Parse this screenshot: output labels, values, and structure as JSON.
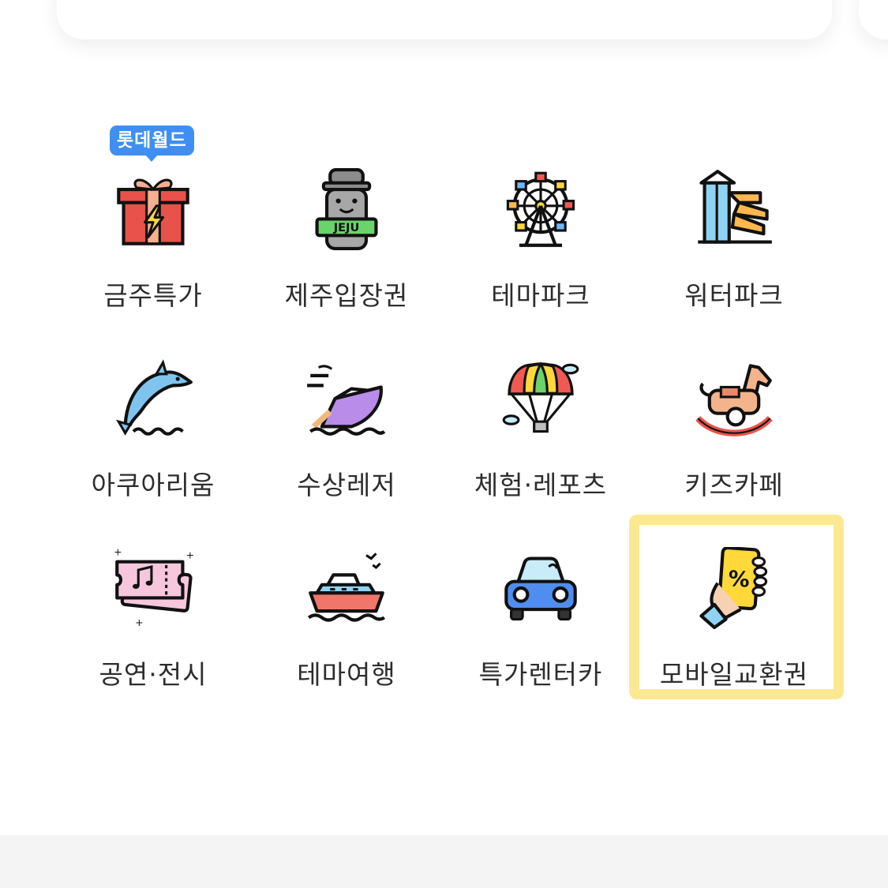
{
  "badge": {
    "label": "롯데월드"
  },
  "categories": [
    {
      "label": "금주특가",
      "icon": "gift-flash-icon"
    },
    {
      "label": "제주입장권",
      "icon": "jeju-stone-statue-icon"
    },
    {
      "label": "테마파크",
      "icon": "ferris-wheel-icon"
    },
    {
      "label": "워터파크",
      "icon": "water-slide-icon"
    },
    {
      "label": "아쿠아리움",
      "icon": "dolphin-icon"
    },
    {
      "label": "수상레저",
      "icon": "speedboat-icon"
    },
    {
      "label": "체험·레포츠",
      "icon": "parachute-icon"
    },
    {
      "label": "키즈카페",
      "icon": "rocking-horse-icon"
    },
    {
      "label": "공연·전시",
      "icon": "ticket-icon"
    },
    {
      "label": "테마여행",
      "icon": "cruise-ship-icon"
    },
    {
      "label": "특가렌터카",
      "icon": "car-icon"
    },
    {
      "label": "모바일교환권",
      "icon": "mobile-coupon-icon"
    }
  ],
  "jeju_sign": "JEJU",
  "colors": {
    "badge": "#3f8ff2",
    "highlight": "#fce06e",
    "label_text": "#2d2d2d"
  }
}
